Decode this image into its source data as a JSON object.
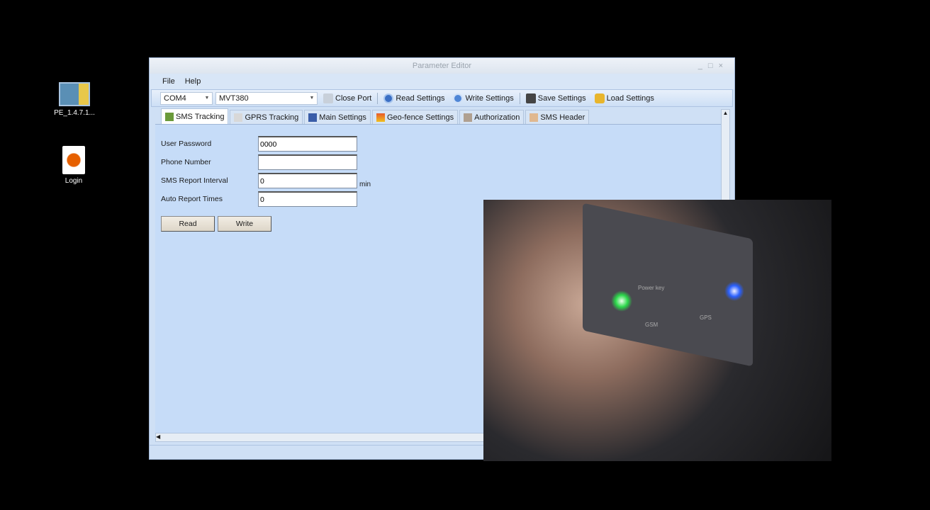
{
  "desktop": {
    "icons": [
      {
        "label": "PE_1.4.7.1..."
      },
      {
        "label": "Login"
      }
    ]
  },
  "window": {
    "title": "Parameter Editor",
    "controls": [
      "_",
      "□",
      "×"
    ]
  },
  "menu": [
    "File",
    "Help"
  ],
  "toolbar": {
    "port": "COM4",
    "device": "MVT380",
    "close_port": "Close Port",
    "read_settings": "Read Settings",
    "write_settings": "Write Settings",
    "save_settings": "Save Settings",
    "load_settings": "Load Settings"
  },
  "tabs": [
    "SMS Tracking",
    "GPRS Tracking",
    "Main Settings",
    "Geo-fence Settings",
    "Authorization",
    "SMS Header"
  ],
  "form": {
    "user_password": {
      "label": "User Password",
      "value": "0000"
    },
    "phone_number": {
      "label": "Phone Number",
      "value": ""
    },
    "sms_report_interval": {
      "label": "SMS Report Interval",
      "value": "0",
      "unit": "min"
    },
    "auto_report_times": {
      "label": "Auto Report Times",
      "value": "0"
    },
    "read": "Read",
    "write": "Write"
  },
  "photo_labels": {
    "power_key": "Power key",
    "gsm": "GSM",
    "gps": "GPS"
  }
}
